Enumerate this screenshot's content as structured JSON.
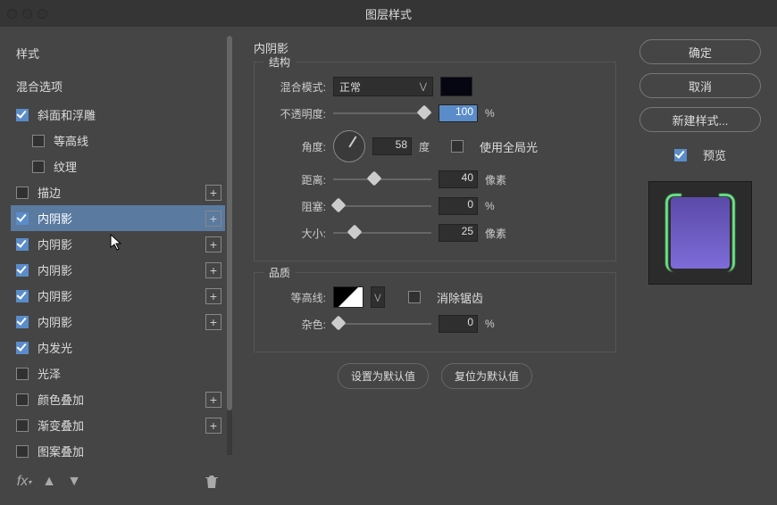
{
  "title": "图层样式",
  "left": {
    "header": "样式",
    "blend_options": "混合选项",
    "items": [
      {
        "label": "斜面和浮雕",
        "checked": true,
        "indent": false,
        "plus": false
      },
      {
        "label": "等高线",
        "checked": false,
        "indent": true,
        "plus": false
      },
      {
        "label": "纹理",
        "checked": false,
        "indent": true,
        "plus": false
      },
      {
        "label": "描边",
        "checked": false,
        "indent": false,
        "plus": true
      },
      {
        "label": "内阴影",
        "checked": true,
        "indent": false,
        "plus": true,
        "selected": true
      },
      {
        "label": "内阴影",
        "checked": true,
        "indent": false,
        "plus": true
      },
      {
        "label": "内阴影",
        "checked": true,
        "indent": false,
        "plus": true
      },
      {
        "label": "内阴影",
        "checked": true,
        "indent": false,
        "plus": true
      },
      {
        "label": "内阴影",
        "checked": true,
        "indent": false,
        "plus": true
      },
      {
        "label": "内发光",
        "checked": true,
        "indent": false,
        "plus": false
      },
      {
        "label": "光泽",
        "checked": false,
        "indent": false,
        "plus": false
      },
      {
        "label": "颜色叠加",
        "checked": false,
        "indent": false,
        "plus": true
      },
      {
        "label": "渐变叠加",
        "checked": false,
        "indent": false,
        "plus": true
      },
      {
        "label": "图案叠加",
        "checked": false,
        "indent": false,
        "plus": false
      }
    ],
    "footer": {
      "fx": "fx",
      "trash": "trash"
    }
  },
  "center": {
    "title": "内阴影",
    "structure_legend": "结构",
    "blend_mode_label": "混合模式:",
    "blend_mode_value": "正常",
    "shadow_color": "#060612",
    "opacity_label": "不透明度:",
    "opacity_value": "100",
    "opacity_unit": "%",
    "angle_label": "角度:",
    "angle_value": "58",
    "angle_unit": "度",
    "global_light_label": "使用全局光",
    "global_light_checked": false,
    "distance_label": "距离:",
    "distance_value": "40",
    "distance_unit": "像素",
    "choke_label": "阻塞:",
    "choke_value": "0",
    "choke_unit": "%",
    "size_label": "大小:",
    "size_value": "25",
    "size_unit": "像素",
    "quality_legend": "品质",
    "contour_label": "等高线:",
    "antialias_label": "消除锯齿",
    "antialias_checked": false,
    "noise_label": "杂色:",
    "noise_value": "0",
    "noise_unit": "%",
    "default_btn": "设置为默认值",
    "reset_btn": "复位为默认值"
  },
  "right": {
    "ok": "确定",
    "cancel": "取消",
    "new_style": "新建样式...",
    "preview_label": "预览",
    "preview_checked": true
  }
}
